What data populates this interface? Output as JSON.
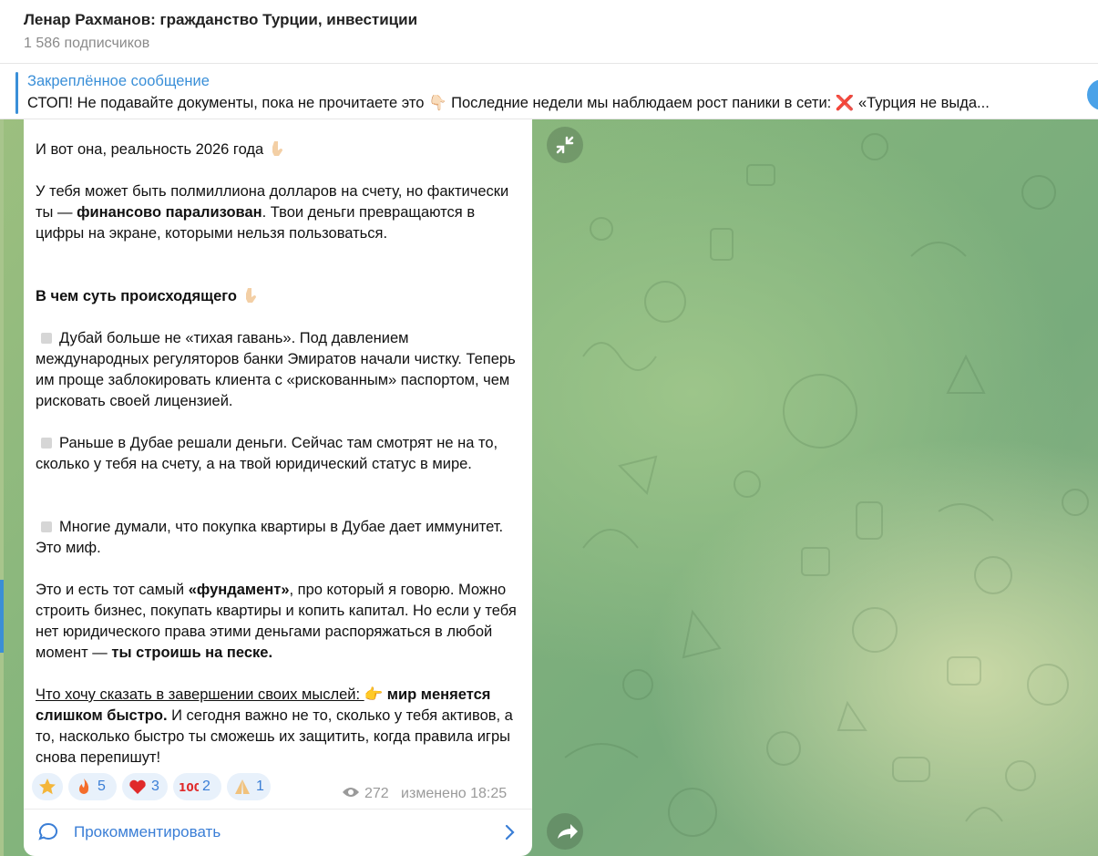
{
  "channel": {
    "title": "Ленар Рахманов: гражданство Турции, инвестиции",
    "subscribers": "1 586 подписчиков"
  },
  "pinned": {
    "label": "Закреплённое сообщение",
    "text": "СТОП! Не подавайте документы, пока не прочитаете это 👇🏻  Последние недели мы наблюдаем рост паники в сети:  ❌ «Турция не выда..."
  },
  "message": {
    "p1": "И вот она, реальность 2026 года",
    "p2_a": "У тебя может быть полмиллиона долларов на счету, но фактически ты — ",
    "p2_b": "финансово парализован",
    "p2_c": ". Твои деньги превращаются в цифры на экране, которыми нельзя пользоваться.",
    "h1": "В чем суть происходящего",
    "bullet1": "Дубай больше не «тихая гавань». Под давлением международных регуляторов банки Эмиратов начали чистку. Теперь им проще заблокировать клиента с «рискованным» паспортом, чем рисковать своей лицензией.",
    "bullet2": "Раньше в Дубае решали деньги. Сейчас там смотрят не на то, сколько у тебя на счету, а на твой юридический статус в мире.",
    "bullet3": "Многие думали, что покупка квартиры в Дубае дает иммунитет. Это миф.",
    "p4_a": "Это и есть тот самый ",
    "p4_b": "«фундамент»",
    "p4_c": ", про который я говорю. Можно строить бизнес, покупать квартиры и копить капитал. Но если у тебя нет юридического права этими деньгами распоряжаться в любой момент — ",
    "p4_d": "ты строишь на песке.",
    "p5_a": "Что хочу сказать в завершении своих мыслей: ",
    "p5_b": "👉",
    "p5_c": " мир меняется слишком быстро.",
    "p5_d": " И сегодня важно не то, сколько у тебя активов, а то, насколько быстро ты сможешь их защитить, когда правила игры снова перепишут!",
    "views": "272",
    "edited": "изменено 18:25"
  },
  "reactions": [
    {
      "icon": "star-icon",
      "count": ""
    },
    {
      "icon": "fire-icon",
      "count": "5"
    },
    {
      "icon": "heart-icon",
      "count": "3"
    },
    {
      "icon": "hundred-icon",
      "count": "2"
    },
    {
      "icon": "pray-icon",
      "count": "1"
    }
  ],
  "comment": {
    "label": "Прокомментировать"
  },
  "colors": {
    "accent": "#3a8fd8",
    "link": "#3a7ed6",
    "meta": "#9a9a9a"
  }
}
